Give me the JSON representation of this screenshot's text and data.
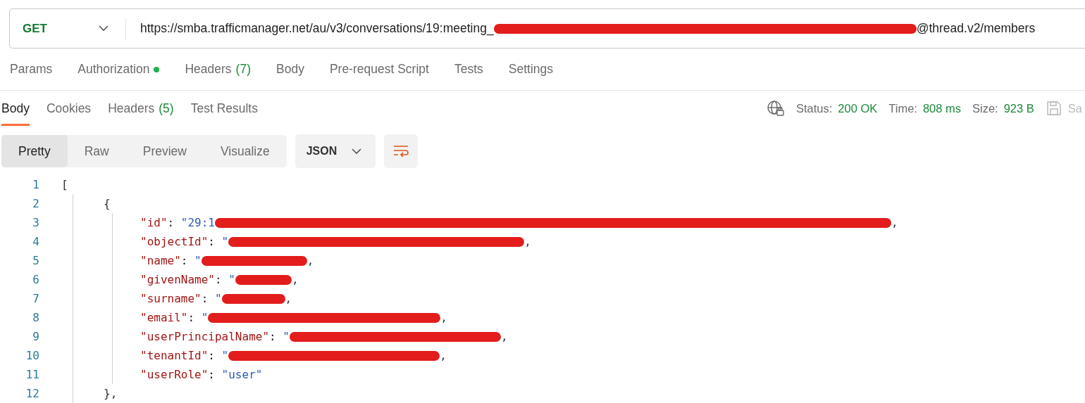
{
  "request": {
    "method": "GET",
    "url_start": "https://smba.trafficmanager.net/au/v3/conversations/19:meeting_",
    "url_redacted": true,
    "url_end": "@thread.v2/members"
  },
  "request_tabs": [
    {
      "label": "Params",
      "dot": false,
      "selected": false
    },
    {
      "label": "Authorization",
      "dot": true,
      "selected": false
    },
    {
      "label": "Headers",
      "count": "(7)",
      "dot": false,
      "selected": false
    },
    {
      "label": "Body",
      "dot": false,
      "selected": false
    },
    {
      "label": "Pre-request Script",
      "dot": false,
      "selected": false
    },
    {
      "label": "Tests",
      "dot": false,
      "selected": false
    },
    {
      "label": "Settings",
      "dot": false,
      "selected": false
    }
  ],
  "response_tabs": [
    {
      "label": "Body",
      "selected": true
    },
    {
      "label": "Cookies",
      "selected": false
    },
    {
      "label": "Headers",
      "count": "(5)",
      "selected": false
    },
    {
      "label": "Test Results",
      "selected": false
    }
  ],
  "response_meta": [
    {
      "label": "Status:",
      "value": "200 OK"
    },
    {
      "label": "Time:",
      "value": "808 ms"
    },
    {
      "label": "Size:",
      "value": "923 B"
    }
  ],
  "save_label": "Sa",
  "view_modes": [
    {
      "label": "Pretty",
      "selected": true
    },
    {
      "label": "Raw",
      "selected": false
    },
    {
      "label": "Preview",
      "selected": false
    },
    {
      "label": "Visualize",
      "selected": false
    }
  ],
  "format": "JSON",
  "code_lines": [
    {
      "number": "1",
      "kind": "punct",
      "text": "["
    },
    {
      "number": "2",
      "kind": "punct",
      "text": "{"
    },
    {
      "number": "3",
      "kind": "pair",
      "key": "\"id\"",
      "sep": ": ",
      "value": "\"29:1",
      "redacted": true,
      "tail": ","
    },
    {
      "number": "4",
      "kind": "pair",
      "key": "\"objectId\"",
      "sep": ": ",
      "value": "\"",
      "redacted": true,
      "tail": ","
    },
    {
      "number": "5",
      "kind": "pair",
      "key": "\"name\"",
      "sep": ": ",
      "value": "\"",
      "redacted": true,
      "tail": ","
    },
    {
      "number": "6",
      "kind": "pair",
      "key": "\"givenName\"",
      "sep": ": ",
      "value": "\"",
      "redacted": true,
      "tail": ","
    },
    {
      "number": "7",
      "kind": "pair",
      "key": "\"surname\"",
      "sep": ": ",
      "value": "\"",
      "redacted": true,
      "tail": ","
    },
    {
      "number": "8",
      "kind": "pair",
      "key": "\"email\"",
      "sep": ": ",
      "value": "\"",
      "redacted": true,
      "tail": ","
    },
    {
      "number": "9",
      "kind": "pair",
      "key": "\"userPrincipalName\"",
      "sep": ": ",
      "value": "\"",
      "redacted": true,
      "tail": ","
    },
    {
      "number": "10",
      "kind": "pair",
      "key": "\"tenantId\"",
      "sep": ": ",
      "value": "\"",
      "redacted": true,
      "tail": ","
    },
    {
      "number": "11",
      "kind": "pair",
      "key": "\"userRole\"",
      "sep": ": ",
      "value": "\"user\"",
      "redacted": false
    },
    {
      "number": "12",
      "kind": "punct",
      "text": "},"
    }
  ]
}
